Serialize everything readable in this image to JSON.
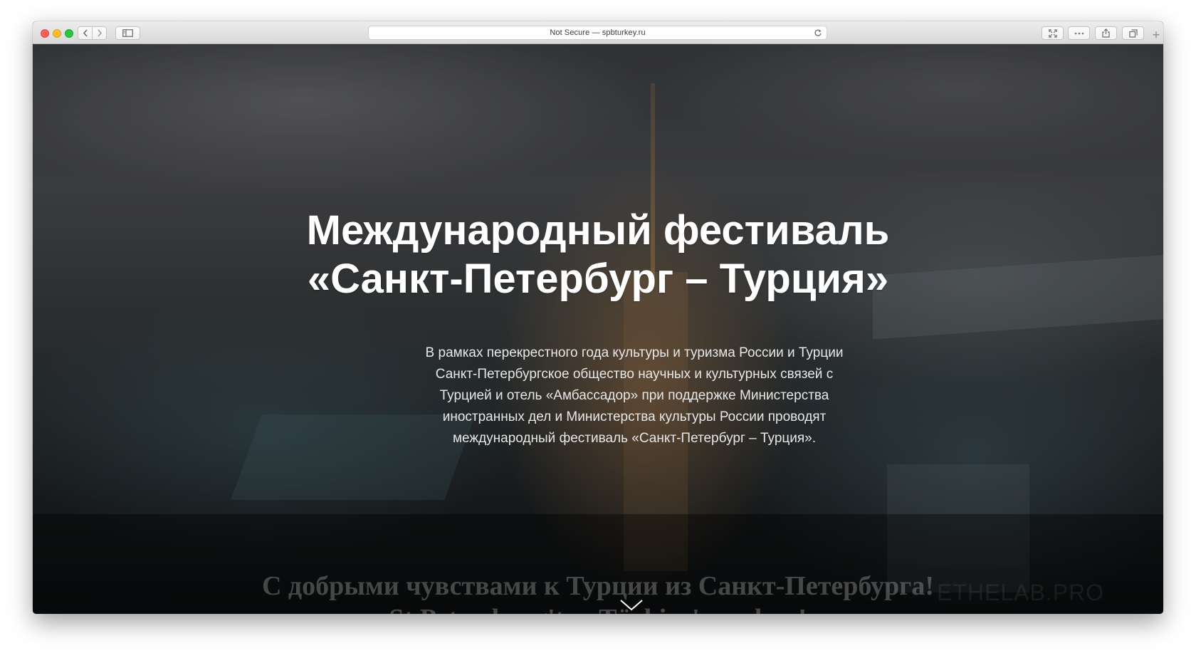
{
  "browser": {
    "address_text": "Not Secure — spbturkey.ru",
    "new_tab_label": "+"
  },
  "hero": {
    "title_line1": "Международный фестиваль",
    "title_line2": "«Санкт-Петербург – Турция»",
    "description": "В рамках перекрестного года культуры и туризма России и Турции Санкт-Петербургское общество научных и культурных связей с Турцией и отель «Амбассадор» при поддержке Министерства иностранных дел и Министерства культуры России проводят международный фестиваль «Санкт-Петербург – Турция»."
  },
  "video_caption": {
    "line1": "С добрыми чувствами к Турции из Санкт-Петербурга!",
    "line2": "St.Petersburg'tan Türkiye'ye selam!",
    "brand": "ETHELAB.PRO"
  },
  "icons": {
    "back": "chevron-left-icon",
    "forward": "chevron-right-icon",
    "sidebar": "sidebar-icon",
    "reload": "reload-icon",
    "fullscreen": "fullscreen-icon",
    "more": "more-icon",
    "share": "share-icon",
    "tabs": "tabs-overview-icon",
    "scroll": "chevron-down-icon"
  },
  "colors": {
    "close": "#fc5f57",
    "minimize": "#fdbc2e",
    "zoom": "#29c840",
    "hero_text": "#ffffff"
  }
}
